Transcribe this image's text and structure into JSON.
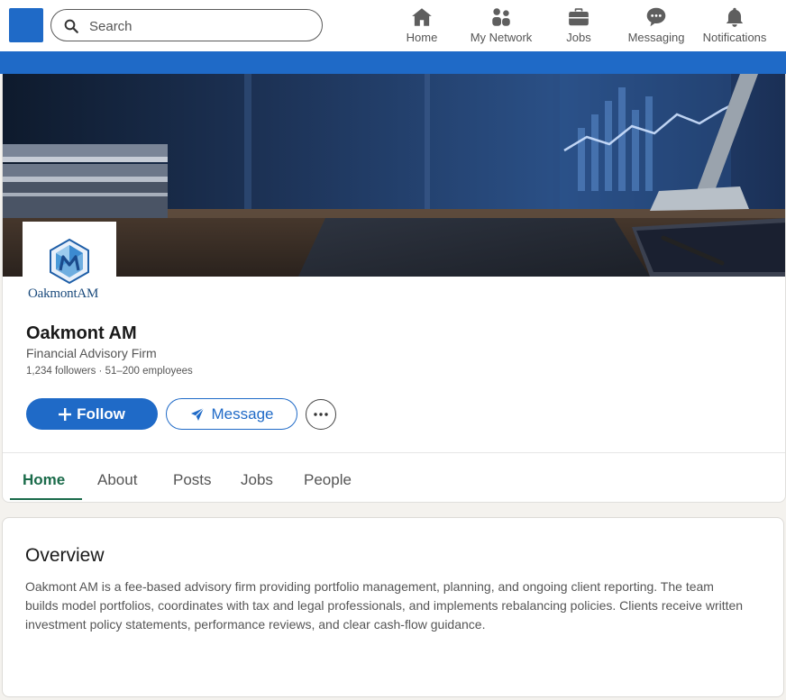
{
  "search": {
    "placeholder": "Search"
  },
  "nav": {
    "items": [
      {
        "label": "Home",
        "icon": "home-icon"
      },
      {
        "label": "My Network",
        "icon": "network-icon"
      },
      {
        "label": "Jobs",
        "icon": "briefcase-icon"
      },
      {
        "label": "Messaging",
        "icon": "message-bubble-icon"
      },
      {
        "label": "Notifications",
        "icon": "bell-icon"
      }
    ]
  },
  "colors": {
    "brand": "#1f6ac7",
    "active_tab": "#1a6b4a"
  },
  "company": {
    "logo_text": "OakmontAM",
    "name": "Oakmont AM",
    "type": "Financial Advisory Firm",
    "meta": "1,234 followers · 51–200 employees"
  },
  "actions": {
    "follow_label": "Follow",
    "message_label": "Message"
  },
  "tabs": [
    {
      "label": "Home",
      "active": true
    },
    {
      "label": "About"
    },
    {
      "label": "Posts"
    },
    {
      "label": "Jobs"
    },
    {
      "label": "People"
    }
  ],
  "overview": {
    "title": "Overview",
    "text": "Oakmont AM is a fee-based advisory firm providing portfolio management, planning, and ongoing client reporting. The team builds model portfolios, coordinates with tax and legal professionals, and implements rebalancing policies. Clients receive written investment policy statements, performance reviews, and clear cash-flow guidance."
  }
}
